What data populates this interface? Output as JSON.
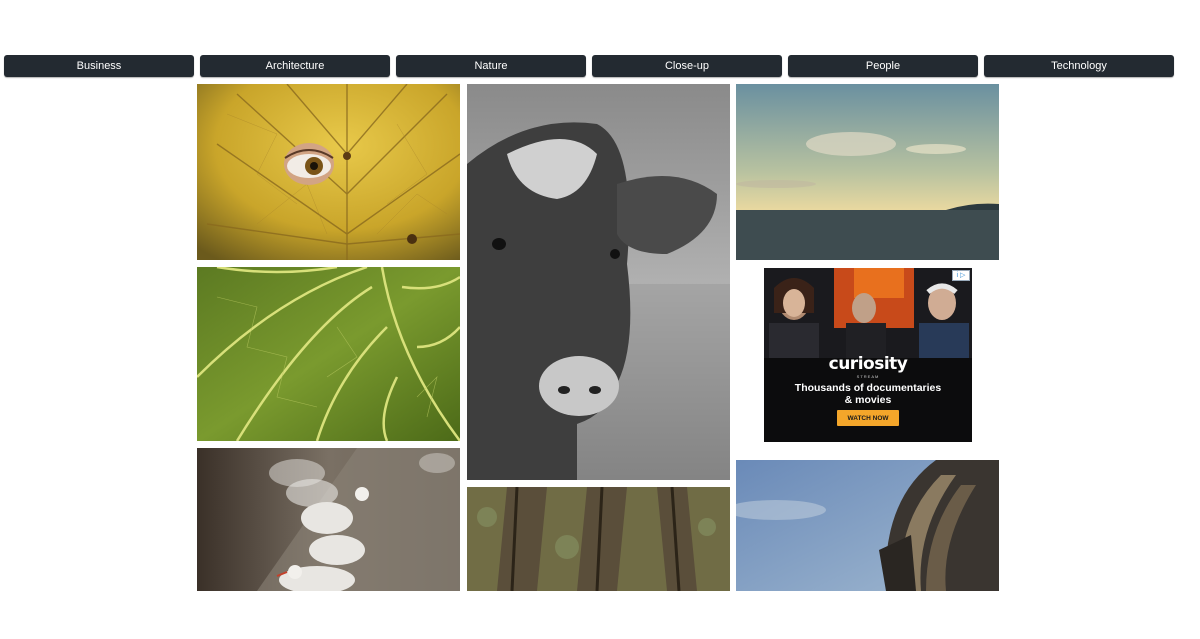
{
  "nav": {
    "items": [
      {
        "label": "Business"
      },
      {
        "label": "Architecture"
      },
      {
        "label": "Nature"
      },
      {
        "label": "Close-up"
      },
      {
        "label": "People"
      },
      {
        "label": "Technology"
      }
    ],
    "button_color": "#232a31",
    "text_color": "#ffffff"
  },
  "gallery": {
    "tiles": [
      {
        "subject": "yellow leaf with eye"
      },
      {
        "subject": "green leaf veins"
      },
      {
        "subject": "seagulls on ledge"
      },
      {
        "subject": "black and white cow portrait"
      },
      {
        "subject": "tree bark texture"
      },
      {
        "subject": "sunset sky over sea"
      },
      {
        "subject": "modern building facade against blue sky"
      }
    ]
  },
  "ad": {
    "adchoices": "i ▷",
    "logo": "curiosity",
    "logo_sub": "STREAM",
    "headline_line1": "Thousands of documentaries",
    "headline_line2": "& movies",
    "cta": "WATCH NOW",
    "cta_color": "#f4a62a"
  }
}
